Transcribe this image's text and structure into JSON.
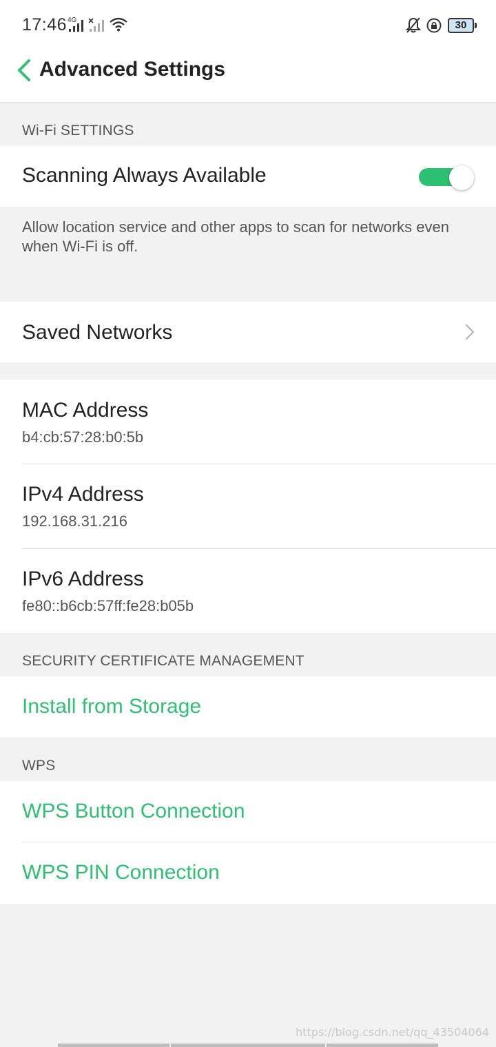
{
  "status_bar": {
    "time": "17:46",
    "network": "4G",
    "battery": "30",
    "icons": [
      "signal-icon",
      "signal-disabled-icon",
      "wifi-icon",
      "bell-muted-icon",
      "rotation-lock-icon",
      "battery-icon"
    ]
  },
  "header": {
    "back_icon": "chevron-left-icon",
    "title": "Advanced Settings"
  },
  "wifi_settings": {
    "section_label": "Wi-Fi SETTINGS",
    "scanning": {
      "label": "Scanning Always Available",
      "enabled": true,
      "description": "Allow location service and other apps to scan for networks even when Wi-Fi is off."
    },
    "saved_networks": {
      "label": "Saved Networks",
      "icon": "chevron-right-icon"
    }
  },
  "addresses": [
    {
      "label": "MAC Address",
      "value": "b4:cb:57:28:b0:5b"
    },
    {
      "label": "IPv4 Address",
      "value": "192.168.31.216"
    },
    {
      "label": "IPv6 Address",
      "value": "fe80::b6cb:57ff:fe28:b05b"
    }
  ],
  "security": {
    "section_label": "SECURITY CERTIFICATE MANAGEMENT",
    "install_label": "Install from Storage"
  },
  "wps": {
    "section_label": "WPS",
    "button_connection": "WPS Button Connection",
    "pin_connection": "WPS PIN Connection"
  },
  "watermark": "https://blog.csdn.net/qq_43504064",
  "colors": {
    "accent": "#2fc173",
    "background": "#f2f2f2",
    "surface": "#ffffff"
  }
}
